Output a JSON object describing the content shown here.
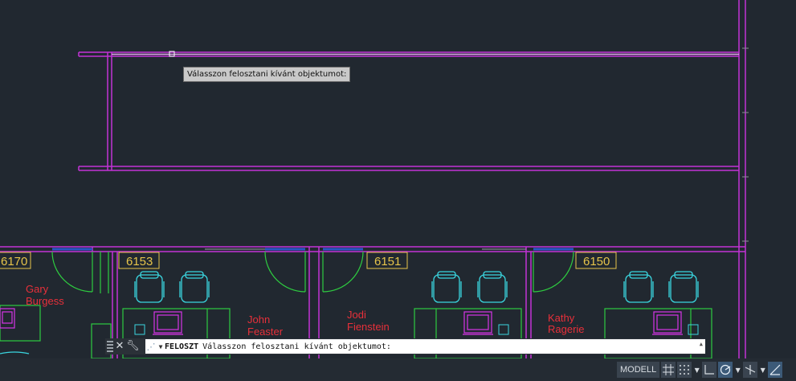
{
  "tooltip": {
    "text": "Válasszon felosztani kívánt objektumot:"
  },
  "rooms": [
    {
      "tag": "6170",
      "occupant_line1": "Gary",
      "occupant_line2": "Burgess"
    },
    {
      "tag": "6153",
      "occupant_line1": "John",
      "occupant_line2": "Feaster"
    },
    {
      "tag": "6151",
      "occupant_line1": "Jodi",
      "occupant_line2": "Fienstein"
    },
    {
      "tag": "6150",
      "occupant_line1": "Kathy",
      "occupant_line2": "Ragerie"
    }
  ],
  "command_line": {
    "command": "FELOSZT",
    "prompt": "Válasszon felosztani kívánt objektumot:",
    "close_icon": "close-icon",
    "customize_icon": "wrench-icon",
    "recent_icon": "command-prompt-icon"
  },
  "status_bar": {
    "model_label": "MODELL",
    "icons": [
      "grid-icon",
      "snap-icon",
      "ortho-icon",
      "polar-icon",
      "isodraft-icon",
      "osnap-tracking-icon"
    ]
  },
  "colors": {
    "background": "#212830",
    "walls": "#c232d6",
    "room_tags": "#e6c44a",
    "occupants": "#e8303a",
    "furniture_cyan": "#3ad6e0",
    "furniture_green": "#2ecc40",
    "windows": "#2a56c8"
  }
}
